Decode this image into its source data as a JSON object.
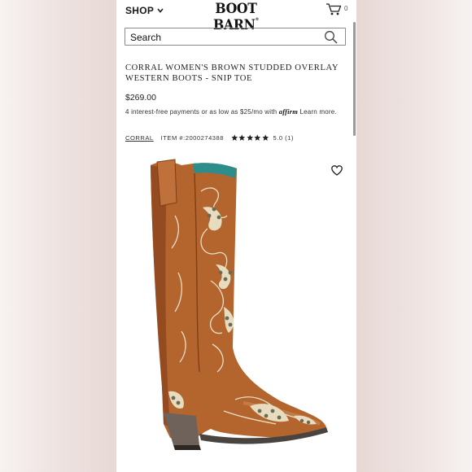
{
  "header": {
    "shop_label": "SHOP",
    "logo_text": "BOOT BARN",
    "cart_count": "0"
  },
  "search": {
    "label": "Search"
  },
  "product": {
    "title": "CORRAL WOMEN'S BROWN STUDDED OVERLAY WESTERN BOOTS - SNIP TOE",
    "price": "$269.00",
    "financing_prefix": "4 interest-free payments or as low as $25/mo with",
    "financing_brand": "affirm",
    "financing_link": "Learn more.",
    "brand": "CORRAL",
    "item_number": "ITEM #:2000274388",
    "rating": 5.0,
    "rating_text": "5.0 (1)",
    "stars_filled": 5
  },
  "icons": {
    "chevron": "chevron-down-icon",
    "cart": "cart-icon",
    "search": "search-icon",
    "heart": "heart-icon",
    "star": "star-icon"
  },
  "colors": {
    "boot_leather": "#b4652e",
    "boot_shadow": "#7e3f17",
    "stitching": "#e9dfc9",
    "heel": "#6e625a"
  }
}
